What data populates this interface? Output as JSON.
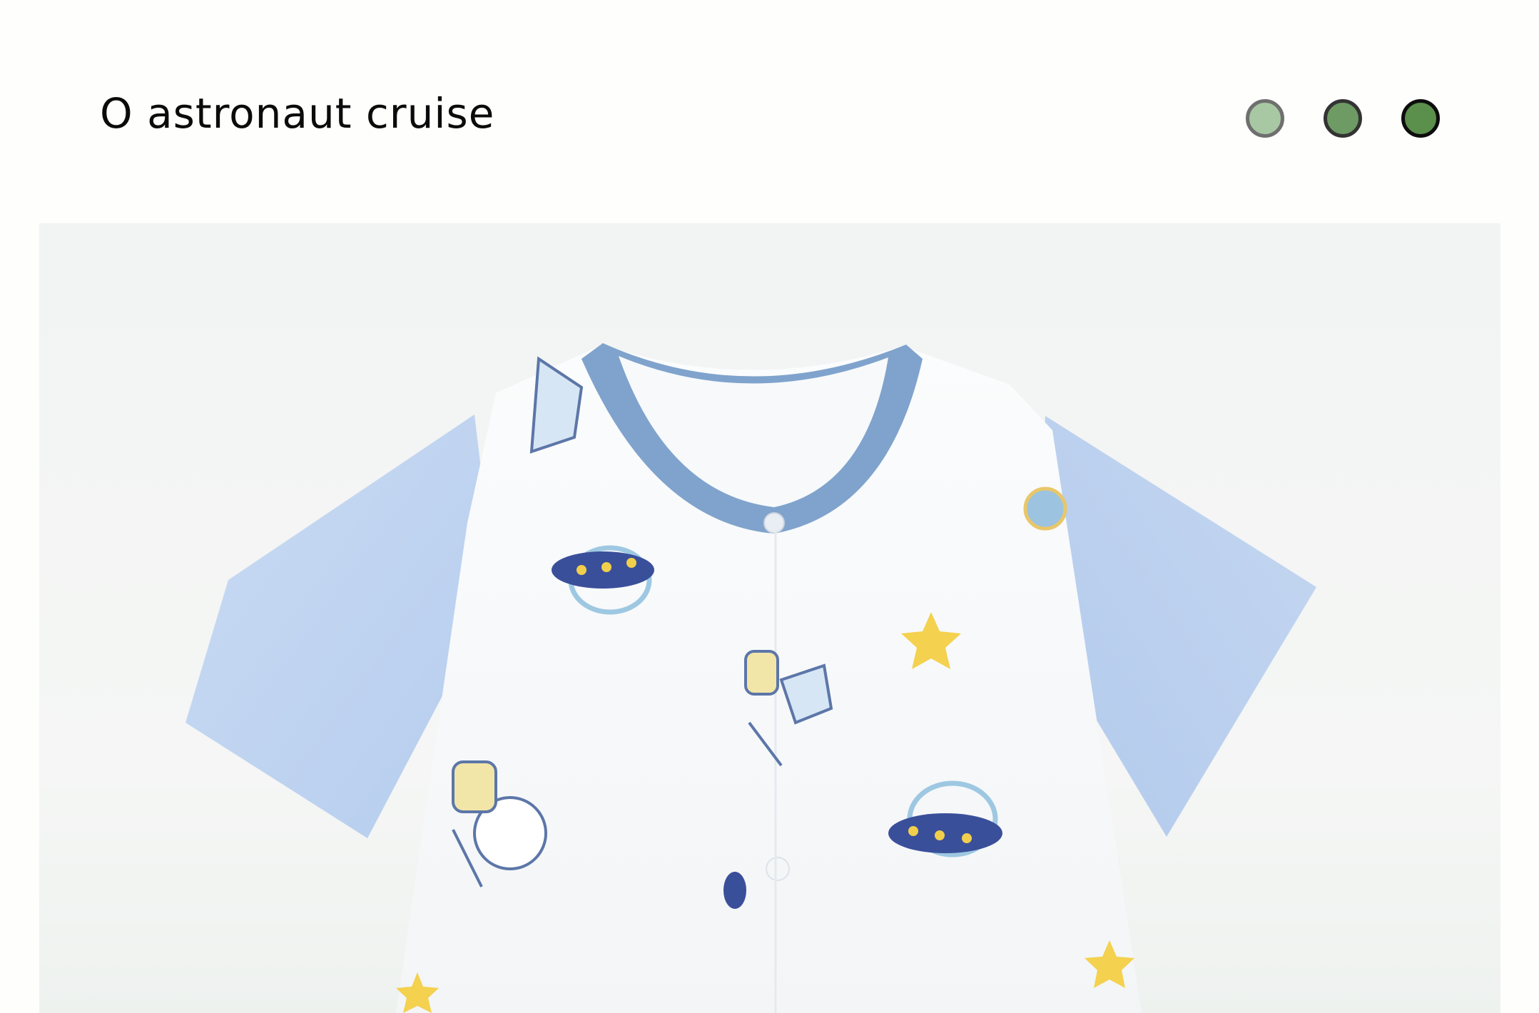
{
  "header": {
    "title": "O astronaut cruise"
  },
  "color_options": [
    {
      "name": "light-green",
      "color": "#a8c8a4"
    },
    {
      "name": "mid-green",
      "color": "#6e9a64"
    },
    {
      "name": "dark-green",
      "color": "#5b8f4c"
    }
  ],
  "photo": {
    "subject": "baby short-sleeve romper with astronaut print"
  }
}
